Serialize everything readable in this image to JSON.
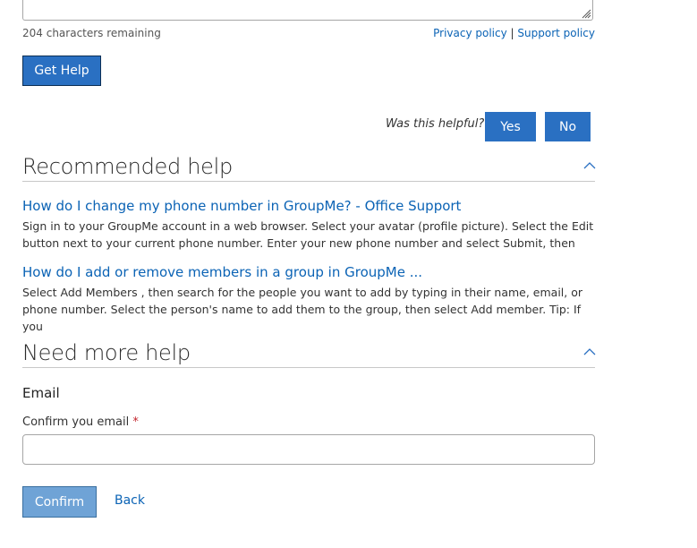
{
  "feedback": {
    "chars_remaining": "204 characters remaining",
    "privacy_link": "Privacy policy",
    "separator": "|",
    "support_link": "Support policy",
    "get_help_label": "Get Help"
  },
  "helpful": {
    "question": "Was this helpful?",
    "yes_label": "Yes",
    "no_label": "No"
  },
  "recommended": {
    "title": "Recommended help",
    "chevron_icon": "chevron-up-icon",
    "items": [
      {
        "title": "How do I change my phone number in GroupMe? - Office Support",
        "description": "Sign in to your GroupMe account in a web browser. Select your avatar (profile picture). Select the Edit button next to your current phone number. Enter your new phone number and select Submit, then"
      },
      {
        "title": "How do I add or remove members in a group in GroupMe ...",
        "description": "Select Add Members , then search for the people you want to add by typing in their name, email, or phone number. Select the person's name to add them to the group, then select Add member. Tip: If you"
      }
    ]
  },
  "more_help": {
    "title": "Need more help",
    "chevron_icon": "chevron-up-icon",
    "email_heading": "Email",
    "confirm_label": "Confirm you email",
    "required_mark": "*",
    "email_value": "",
    "confirm_button": "Confirm",
    "back_link": "Back"
  },
  "colors": {
    "accent": "#2a70c2",
    "link": "#0b63b5",
    "disabled_button": "#6fa3d6",
    "required": "#c4262e"
  }
}
